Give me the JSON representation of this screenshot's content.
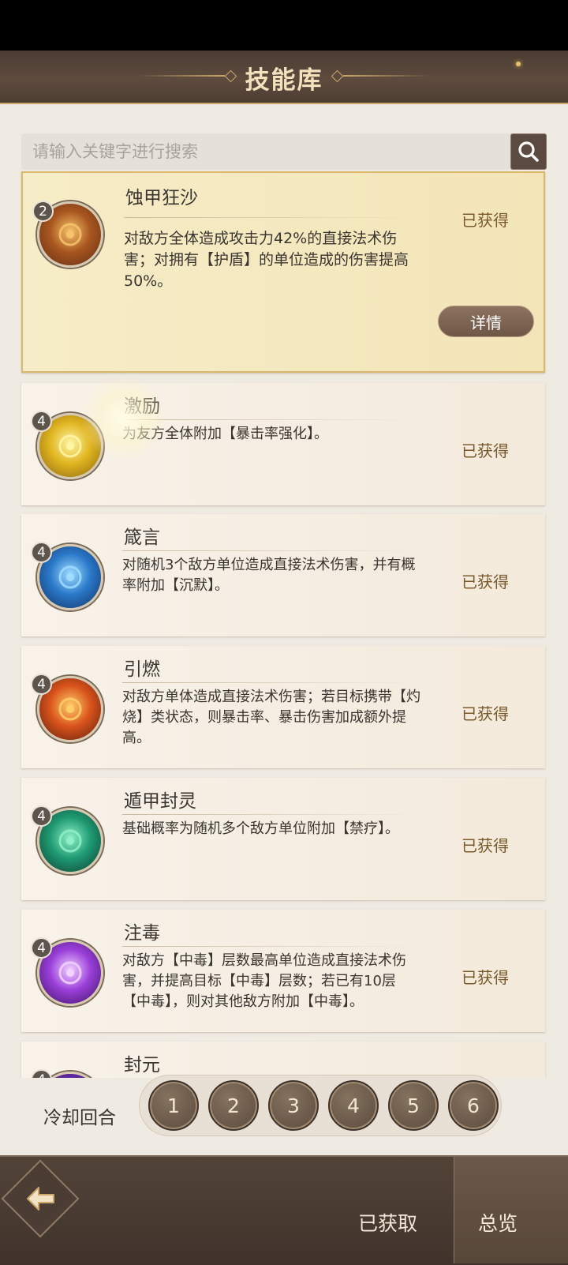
{
  "header": {
    "title": "技能库"
  },
  "search": {
    "placeholder": "请输入关键字进行搜索"
  },
  "skills": [
    {
      "cooldown": "2",
      "name": "蚀甲狂沙",
      "desc": "对敌方全体造成攻击力42%的直接法术伤害；对拥有【护盾】的单位造成的伤害提高50%。",
      "status": "已获得",
      "details_label": "详情",
      "icon": "sandstorm-icon",
      "colors": [
        "#f6c36a",
        "#a8561f",
        "#5e2c14"
      ]
    },
    {
      "cooldown": "4",
      "name": "激励",
      "desc": "为友方全体附加【暴击率强化】。",
      "status": "已获得",
      "icon": "golden-sword-icon",
      "colors": [
        "#fff6a8",
        "#e0b520",
        "#8a6510"
      ]
    },
    {
      "cooldown": "4",
      "name": "箴言",
      "desc": "对随机3个敌方单位造成直接法术伤害，并有概率附加【沉默】。",
      "status": "已获得",
      "icon": "scroll-icon",
      "colors": [
        "#9fdcff",
        "#2a78c9",
        "#13315e"
      ]
    },
    {
      "cooldown": "4",
      "name": "引燃",
      "desc": "对敌方单体造成直接法术伤害；若目标携带【灼烧】类状态，则暴击率、暴击伤害加成额外提高。",
      "status": "已获得",
      "icon": "flame-icon",
      "colors": [
        "#ffcf6a",
        "#d9531c",
        "#5a1d0c"
      ]
    },
    {
      "cooldown": "4",
      "name": "遁甲封灵",
      "desc": "基础概率为随机多个敌方单位附加【禁疗】。",
      "status": "已获得",
      "icon": "talisman-icon",
      "colors": [
        "#8ff0c8",
        "#1f9a72",
        "#0c3b2d"
      ]
    },
    {
      "cooldown": "4",
      "name": "注毒",
      "desc": "对敌方【中毒】层数最高单位造成直接法术伤害，并提高目标【中毒】层数；若已有10层【中毒】，则对其他敌方附加【中毒】。",
      "status": "已获得",
      "icon": "poison-orb-icon",
      "colors": [
        "#f2d2ff",
        "#9a3fd9",
        "#3b1260"
      ]
    },
    {
      "cooldown": "4",
      "name": "封元",
      "desc": "",
      "status": "",
      "icon": "seal-icon",
      "colors": [
        "#c9a3ff",
        "#6a2fb0",
        "#2c0f4f"
      ]
    }
  ],
  "cooldown_filter": {
    "label": "冷却回合",
    "options": [
      "1",
      "2",
      "3",
      "4",
      "5",
      "6"
    ]
  },
  "bottom_nav": {
    "owned_label": "已获取",
    "overview_label": "总览"
  }
}
